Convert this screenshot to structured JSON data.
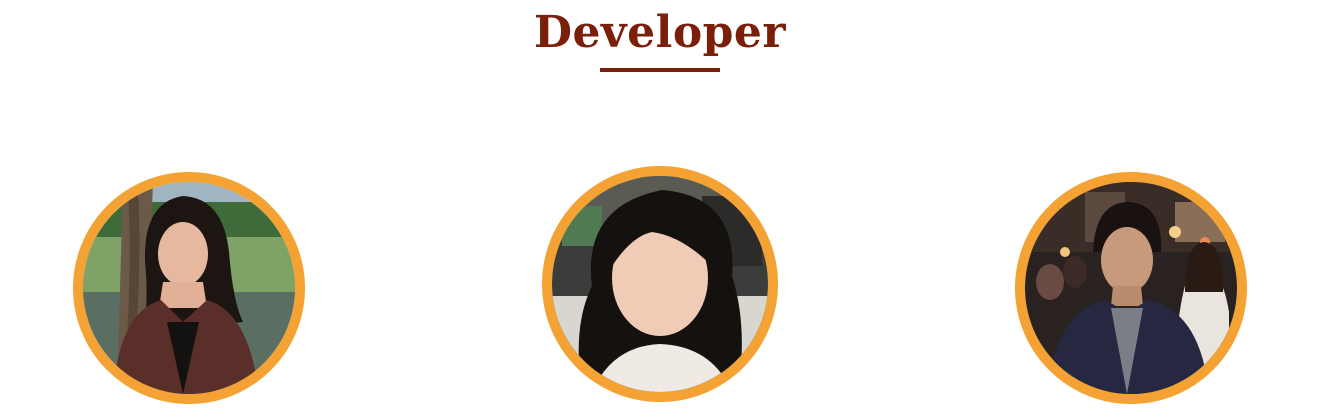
{
  "section": {
    "title": "Developer"
  },
  "colors": {
    "title": "#7a1f0a",
    "avatar_ring": "#f3a233",
    "background": "#ffffff"
  },
  "developers": [
    {
      "photo": "avatar-photo"
    },
    {
      "photo": "avatar-photo"
    },
    {
      "photo": "avatar-photo"
    }
  ]
}
